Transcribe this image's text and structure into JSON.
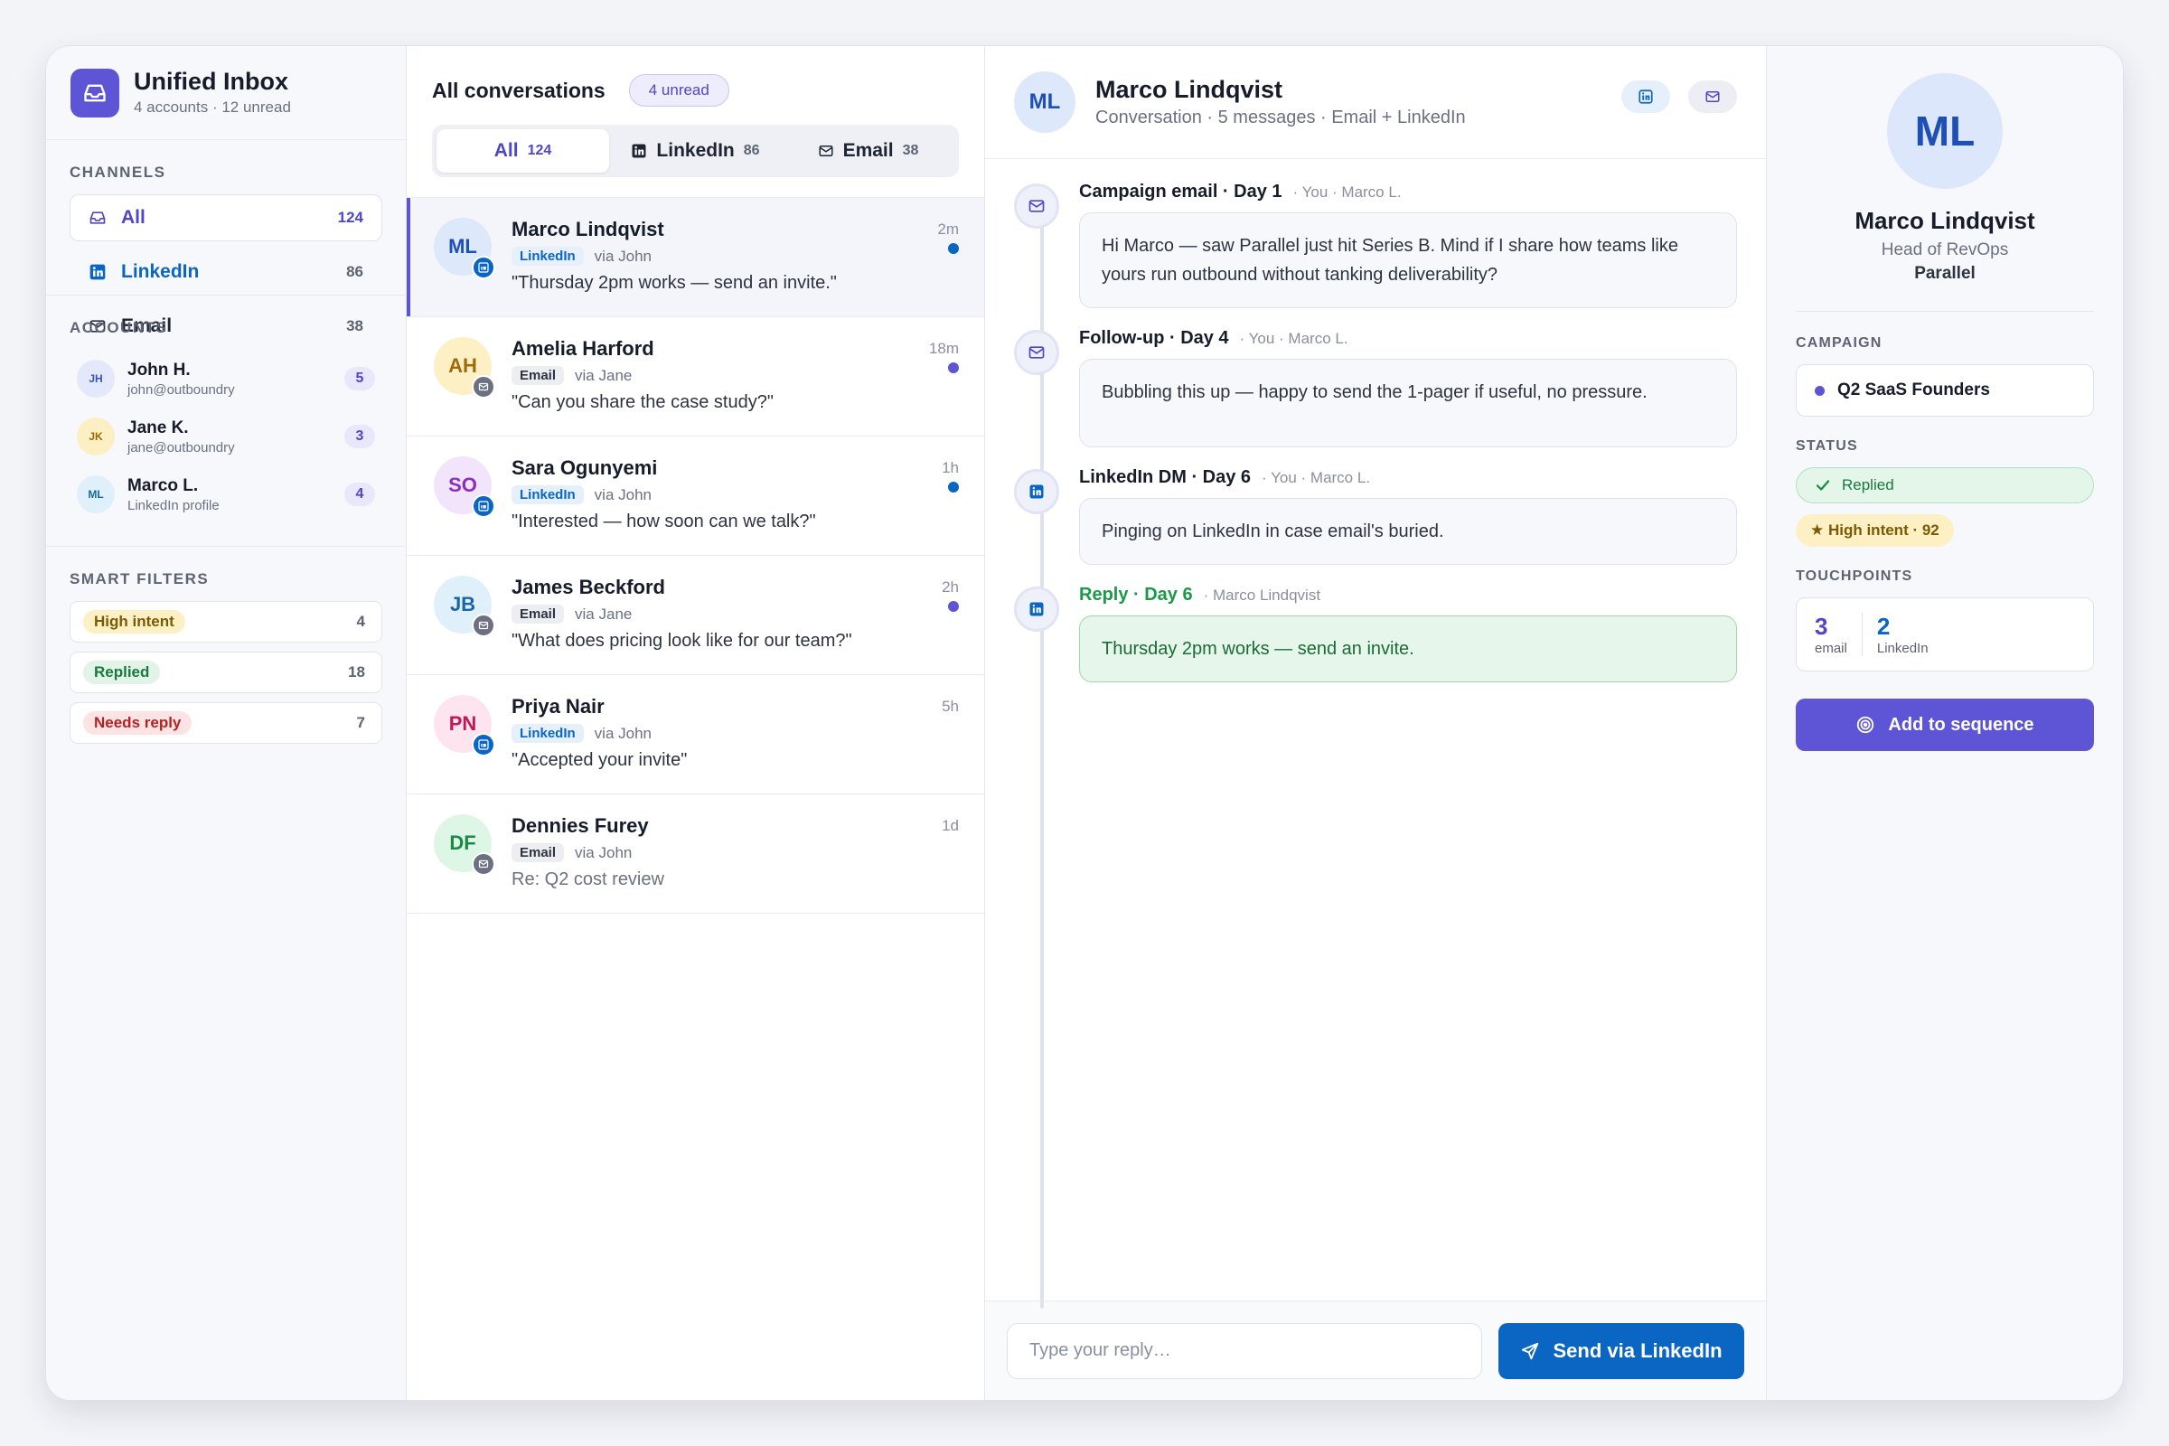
{
  "app": {
    "title": "Unified Inbox",
    "subtitle": "4 accounts · 12 unread",
    "accent": "#5d55d6",
    "linkedin_color": "#0a66c2"
  },
  "sidebar": {
    "channels_label": "CHANNELS",
    "channels": [
      {
        "label": "All",
        "count": "124",
        "icon": "inbox-icon"
      },
      {
        "label": "LinkedIn",
        "count": "86",
        "icon": "linkedin-icon"
      },
      {
        "label": "Email",
        "count": "38",
        "icon": "mail-icon"
      }
    ],
    "accounts_label": "ACCOUNTS",
    "accounts": [
      {
        "initials": "JH",
        "name": "John H.",
        "detail": "john@outboundry",
        "count": "5"
      },
      {
        "initials": "JK",
        "name": "Jane K.",
        "detail": "jane@outboundry",
        "count": "3"
      },
      {
        "initials": "ML",
        "name": "Marco L.",
        "detail": "LinkedIn profile",
        "count": "4"
      }
    ],
    "filters_label": "SMART FILTERS",
    "filters": [
      {
        "label": "High intent",
        "count": "4"
      },
      {
        "label": "Replied",
        "count": "18"
      },
      {
        "label": "Needs reply",
        "count": "7"
      }
    ]
  },
  "list": {
    "title": "All conversations",
    "unread": "4 unread",
    "tabs": [
      {
        "label": "All",
        "count": "124"
      },
      {
        "label": "LinkedIn",
        "count": "86"
      },
      {
        "label": "Email",
        "count": "38"
      }
    ],
    "conversations": [
      {
        "initials": "ML",
        "name": "Marco Lindqvist",
        "time": "2m",
        "channel": "LinkedIn",
        "via": "via John",
        "preview": "\"Thursday 2pm works — send an invite.\"",
        "unread": true
      },
      {
        "initials": "AH",
        "name": "Amelia Harford",
        "time": "18m",
        "channel": "Email",
        "via": "via Jane",
        "preview": "\"Can you share the case study?\"",
        "unread": true
      },
      {
        "initials": "SO",
        "name": "Sara Ogunyemi",
        "time": "1h",
        "channel": "LinkedIn",
        "via": "via John",
        "preview": "\"Interested — how soon can we talk?\"",
        "unread": true
      },
      {
        "initials": "JB",
        "name": "James Beckford",
        "time": "2h",
        "channel": "Email",
        "via": "via Jane",
        "preview": "\"What does pricing look like for our team?\"",
        "unread": true
      },
      {
        "initials": "PN",
        "name": "Priya Nair",
        "time": "5h",
        "channel": "LinkedIn",
        "via": "via John",
        "preview": "\"Accepted your invite\"",
        "unread": false
      },
      {
        "initials": "DF",
        "name": "Dennies Furey",
        "time": "1d",
        "channel": "Email",
        "via": "via John",
        "preview": "Re: Q2 cost review",
        "unread": false
      }
    ]
  },
  "thread": {
    "initials": "ML",
    "name": "Marco Lindqvist",
    "subtitle": "Conversation · 5 messages · Email + LinkedIn",
    "messages": [
      {
        "title": "Campaign email · Day 1",
        "from": "· You · Marco L.",
        "text": "Hi Marco — saw Parallel just hit Series B. Mind if I share how teams like yours run outbound without tanking deliverability?",
        "icon": "mail-icon"
      },
      {
        "title": "Follow-up · Day 4",
        "from": "· You · Marco L.",
        "text": "Bubbling this up — happy to send the 1-pager if useful, no pressure.",
        "icon": "mail-icon"
      },
      {
        "title": "LinkedIn DM · Day 6",
        "from": "· You · Marco L.",
        "text": "Pinging on LinkedIn in case email's buried.",
        "icon": "linkedin-icon"
      },
      {
        "title": "Reply · Day 6",
        "from": "· Marco Lindqvist",
        "text": "Thursday 2pm works — send an invite.",
        "icon": "linkedin-icon"
      }
    ],
    "composer_placeholder": "Type your reply…",
    "send_label": "Send via LinkedIn"
  },
  "profile": {
    "initials": "ML",
    "name": "Marco Lindqvist",
    "role": "Head of RevOps",
    "company": "Parallel",
    "campaign_label": "CAMPAIGN",
    "campaign": "Q2 SaaS Founders",
    "status_label": "STATUS",
    "status": "Replied",
    "intent": "★ High intent · 92",
    "touchpoints_label": "TOUCHPOINTS",
    "touchpoints": [
      {
        "value": "3",
        "label": "email"
      },
      {
        "value": "2",
        "label": "LinkedIn"
      }
    ],
    "add_label": "Add to sequence"
  }
}
